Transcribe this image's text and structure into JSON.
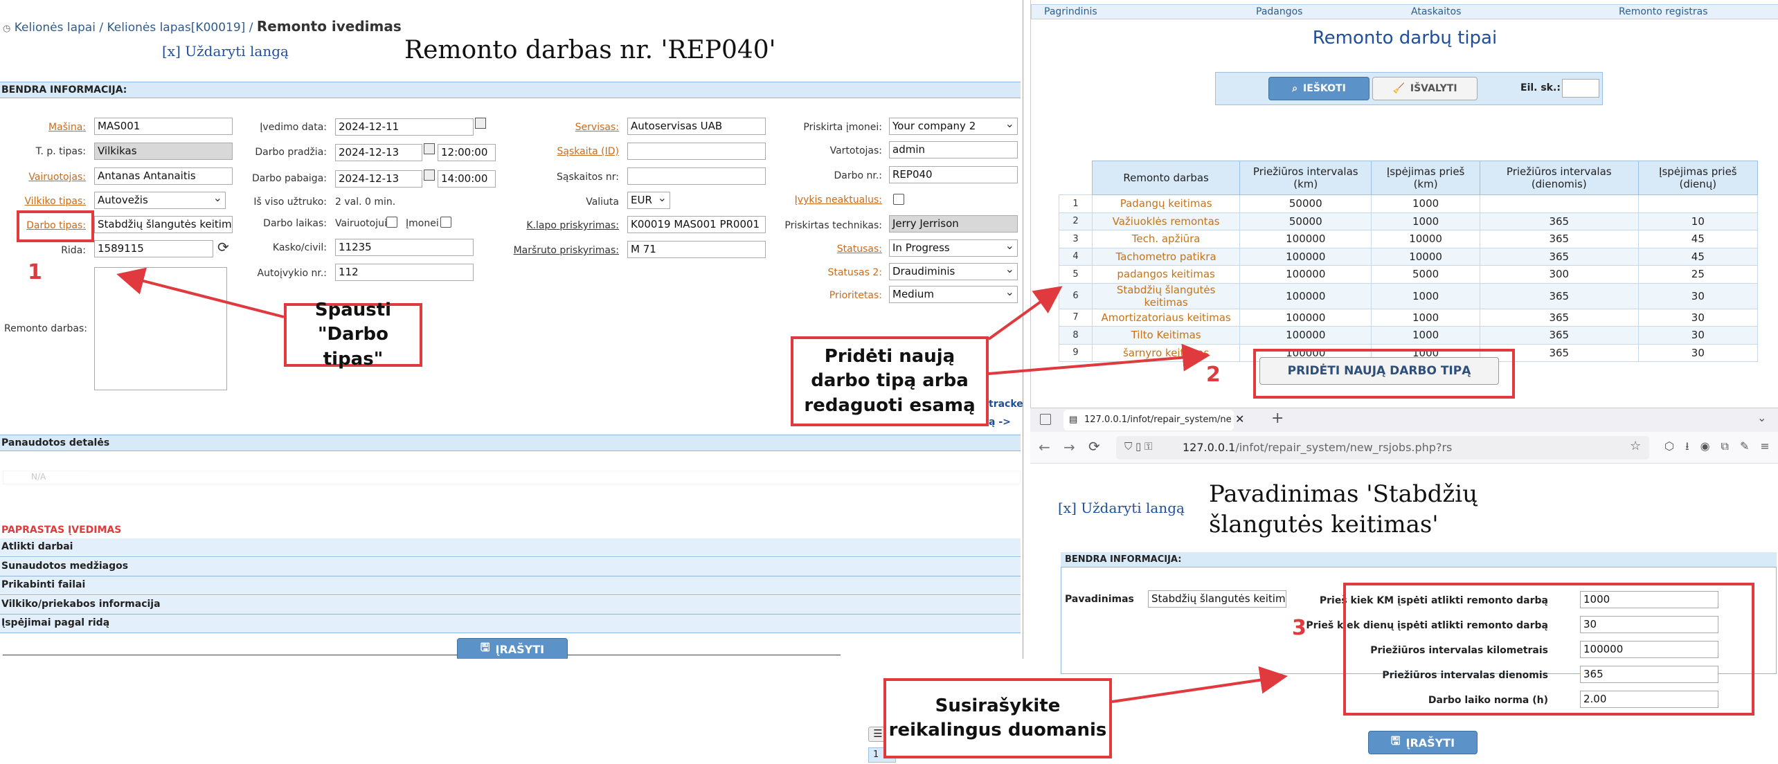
{
  "left": {
    "breadcrumb": {
      "item1": "Kelionės lapai",
      "sep1": "/",
      "item2": "Kelionės lapas[K00019]",
      "sep2": "/",
      "current": "Remonto ivedimas"
    },
    "close_window": "[x] Uždaryti langą",
    "title": "Remonto darbas nr. 'REP040'",
    "section_general": "BENDRA INFORMACIJA:",
    "fields": {
      "masina_label": "Mašina:",
      "masina_value": "MAS001",
      "tp_label": "T. p. tipas:",
      "tp_value": "Vilkikas",
      "vair_label": "Vairuotojas:",
      "vair_value": "Antanas Antanaitis",
      "vilk_label": "Vilkiko tipas:",
      "vilk_value": "Autovežis",
      "darbo_tipas_label": "Darbo tipas:",
      "darbo_tipas_value": "Stabdžių šlangutės keitimas",
      "rida_label": "Rida:",
      "rida_value": "1589115",
      "remonto_label": "Remonto darbas:",
      "ived_label": "Įvedimo data:",
      "ived_value": "2024-12-11",
      "pradzia_label": "Darbo pradžia:",
      "pradzia_date": "2024-12-13",
      "pradzia_time": "12:00:00",
      "pabaiga_label": "Darbo pabaiga:",
      "pabaiga_date": "2024-12-13",
      "pabaiga_time": "14:00:00",
      "viso_label": "Iš viso užtruko:",
      "viso_value": "2 val. 0 min.",
      "laikas_label": "Darbo laikas:",
      "laikas_opt1": "Vairuotojui",
      "laikas_opt2": "Įmonei",
      "kasko_label": "Kasko/civil:",
      "kasko_value": "11235",
      "autoi_label": "Autoįvykio nr.:",
      "autoi_value": "112",
      "servisas_label": "Servisas:",
      "servisas_value": "Autoservisas UAB",
      "saskaita_label": "Sąskaita (ID)",
      "saskaitos_label": "Sąskaitos nr:",
      "valiuta_label": "Valiuta",
      "valiuta_value": "EUR",
      "klapo_label": "K.lapo priskyrimas:",
      "klapo_value": "K00019 MAS001  PR0001",
      "marsruto_label": "Maršruto priskyrimas:",
      "marsruto_value": "M 71",
      "imonei_label": "Priskirta įmonei:",
      "imonei_value": "Your company 2",
      "vartotojas_label": "Vartotojas:",
      "vartotojas_value": "admin",
      "darbo_nr_label": "Darbo nr.:",
      "darbo_nr_value": "REP040",
      "ivykis_label": "Įvykis neaktualus:",
      "technikas_label": "Priskirtas technikas:",
      "technikas_value": "Jerry Jerrison",
      "statusas_label": "Statusas:",
      "statusas_value": "In Progress",
      "statusas2_label": "Statusas 2:",
      "statusas2_value": "Draudiminis",
      "prioritetas_label": "Prioritetas:",
      "prioritetas_value": "Medium"
    },
    "tracker_link": "tracke",
    "ra_link": "ą ->",
    "section_parts": "Panaudotos detalės",
    "na_text": "N/A",
    "simple_entry": "PAPRASTAS ĮVEDIMAS",
    "accordions": [
      "Atlikti darbai",
      "Sunaudotos medžiagos",
      "Prikabinti failai",
      "Vilkiko/priekabos informacija",
      "Įspėjimai pagal ridą"
    ],
    "save_button": "ĮRAŠYTI"
  },
  "annotations": {
    "num1": "1",
    "num2": "2",
    "num3": "3",
    "callout1": "Spausti \"Darbo tipas\"",
    "callout2": "Pridėti naują darbo tipą arba redaguoti esamą",
    "callout3": "Susirašykite reikalingus duomanis",
    "red_color": "#e0393e"
  },
  "right_top": {
    "nav": [
      "Pagrindinis",
      "Padangos",
      "Ataskaitos",
      "Remonto registras"
    ],
    "title": "Remonto darbų tipai",
    "search_button": "IEŠKOTI",
    "clear_button": "IŠVALYTI",
    "eil_label": "Eil. sk.:",
    "columns": [
      "Remonto darbas",
      "Priežiūros intervalas (km)",
      "Įspėjimas prieš (km)",
      "Priežiūros intervalas (dienomis)",
      "Įspėjimas prieš (dienų)"
    ],
    "rows": [
      {
        "n": "1",
        "name": "Padangų keitimas",
        "km": "50000",
        "warn_km": "1000",
        "days": "",
        "warn_days": ""
      },
      {
        "n": "2",
        "name": "Važiuoklės remontas",
        "km": "50000",
        "warn_km": "1000",
        "days": "365",
        "warn_days": "10"
      },
      {
        "n": "3",
        "name": "Tech. apžiūra",
        "km": "100000",
        "warn_km": "10000",
        "days": "365",
        "warn_days": "45"
      },
      {
        "n": "4",
        "name": "Tachometro patikra",
        "km": "100000",
        "warn_km": "10000",
        "days": "365",
        "warn_days": "45"
      },
      {
        "n": "5",
        "name": "padangos keitimas",
        "km": "100000",
        "warn_km": "5000",
        "days": "300",
        "warn_days": "25"
      },
      {
        "n": "6",
        "name": "Stabdžių šlangutės keitimas",
        "km": "100000",
        "warn_km": "1000",
        "days": "365",
        "warn_days": "30"
      },
      {
        "n": "7",
        "name": "Amortizatoriaus keitimas",
        "km": "100000",
        "warn_km": "1000",
        "days": "365",
        "warn_days": "30"
      },
      {
        "n": "8",
        "name": "Tilto Keitimas",
        "km": "100000",
        "warn_km": "1000",
        "days": "365",
        "warn_days": "30"
      },
      {
        "n": "9",
        "name": "šarnyro keitimas",
        "km": "100000",
        "warn_km": "1000",
        "days": "365",
        "warn_days": "30"
      }
    ],
    "add_button": "PRIDĖTI NAUJĄ DARBO TIPĄ"
  },
  "right_bottom": {
    "tab_title": "127.0.0.1/infot/repair_system/ne",
    "url_host": "127.0.0.1",
    "url_path": "/infot/repair_system/new_rsjobs.php?rs",
    "close_window": "[x] Uždaryti langą",
    "title": "Pavadinimas 'Stabdžių šlangutės keitimas'",
    "section_general": "BENDRA INFORMACIJA:",
    "name_label": "Pavadinimas",
    "name_value": "Stabdžių šlangutės keitimas",
    "km_warn_label": "Prieš kiek KM įspėti atlikti remonto darbą",
    "km_warn_value": "1000",
    "day_warn_label": "Prieš kiek dienų įspėti atlikti remonto darbą",
    "day_warn_value": "30",
    "km_int_label": "Priežiūros intervalas kilometrais",
    "km_int_value": "100000",
    "day_int_label": "Priežiūros intervalas dienomis",
    "day_int_value": "365",
    "norm_label": "Darbo laiko norma (h)",
    "norm_value": "2.00",
    "save_button": "ĮRAŠYTI"
  },
  "bottom_fragment": {
    "page_num": "1"
  }
}
